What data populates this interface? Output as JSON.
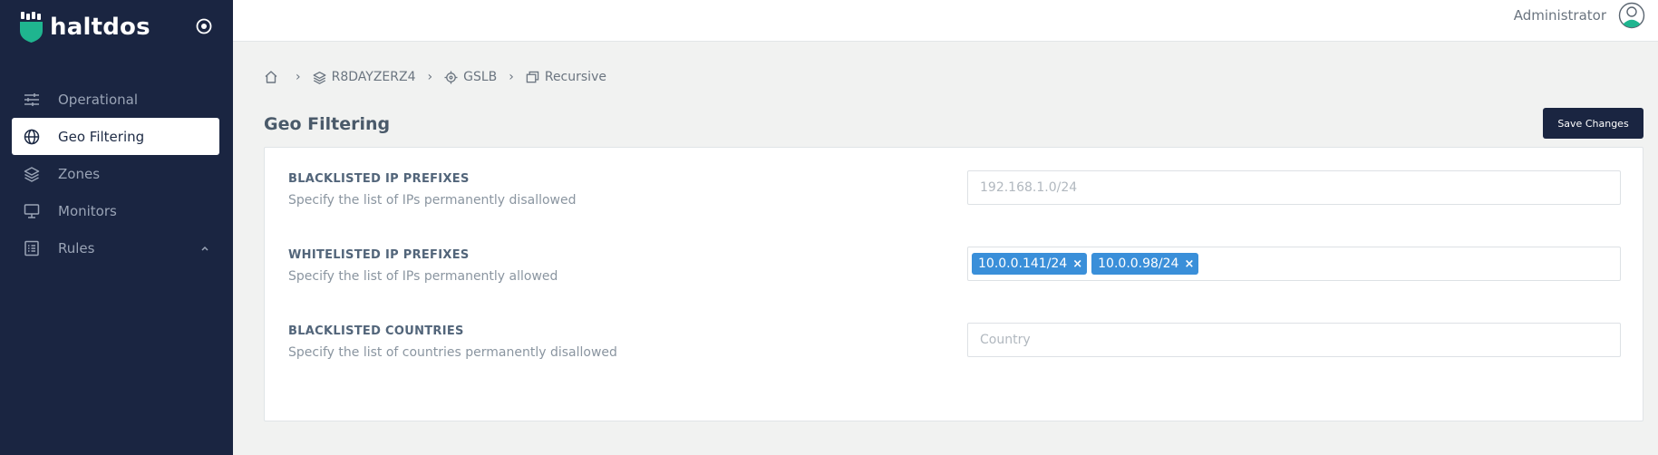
{
  "brand": {
    "name": "haltdos"
  },
  "sidebar": {
    "items": [
      {
        "label": "Operational",
        "icon": "sliders-icon",
        "active": false
      },
      {
        "label": "Geo Filtering",
        "icon": "globe-icon",
        "active": true
      },
      {
        "label": "Zones",
        "icon": "layers-icon",
        "active": false
      },
      {
        "label": "Monitors",
        "icon": "monitor-icon",
        "active": false
      },
      {
        "label": "Rules",
        "icon": "list-icon",
        "active": false,
        "expanded": true
      }
    ]
  },
  "header": {
    "user": "Administrator"
  },
  "breadcrumb": {
    "items": [
      {
        "label": "",
        "icon": "home-icon"
      },
      {
        "label": "R8DAYZERZ4",
        "icon": "layers-icon"
      },
      {
        "label": "GSLB",
        "icon": "target-icon"
      },
      {
        "label": "Recursive",
        "icon": "windows-icon"
      }
    ],
    "separator": "›"
  },
  "page": {
    "title": "Geo Filtering",
    "save_label": "Save Changes"
  },
  "fields": [
    {
      "label": "BLACKLISTED IP PREFIXES",
      "description": "Specify the list of IPs permanently disallowed",
      "placeholder": "192.168.1.0/24",
      "tags": []
    },
    {
      "label": "WHITELISTED IP PREFIXES",
      "description": "Specify the list of IPs permanently allowed",
      "placeholder": "",
      "tags": [
        "10.0.0.141/24",
        "10.0.0.98/24"
      ]
    },
    {
      "label": "BLACKLISTED COUNTRIES",
      "description": "Specify the list of countries permanently disallowed",
      "placeholder": "Country",
      "tags": []
    }
  ],
  "colors": {
    "sidebar": "#1a2541",
    "tag": "#3a8fd9",
    "avatar_accent": "#1fb58f"
  }
}
